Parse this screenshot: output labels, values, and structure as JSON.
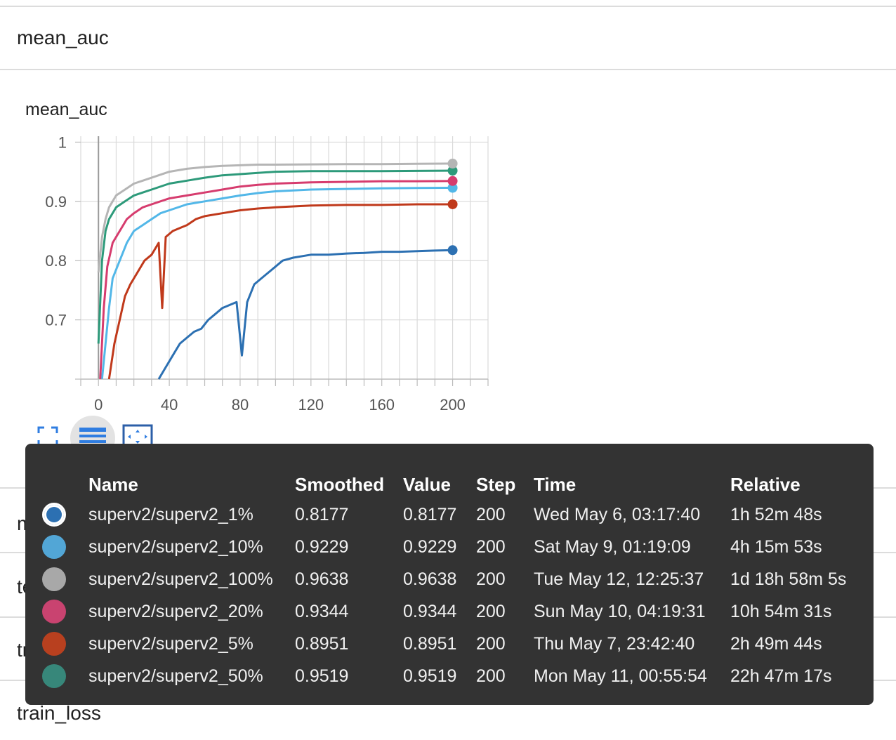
{
  "page": {
    "section_title": "mean_auc",
    "card_title": "mean_auc",
    "other_sections": [
      "mean_auc_train",
      "test_loss",
      "train_auc",
      "train_loss"
    ]
  },
  "toolbar": {
    "expand_icon": "fullscreen-icon",
    "legend_icon": "list-icon",
    "fit_icon": "fit-domain-icon"
  },
  "chart_data": {
    "type": "line",
    "xlim": [
      -10,
      220
    ],
    "ylim": [
      0.6,
      1.01
    ],
    "x_ticks": [
      "0",
      "40",
      "80",
      "120",
      "160",
      "200"
    ],
    "x_tick_values": [
      0,
      40,
      80,
      120,
      160,
      200
    ],
    "y_ticks": [
      "1",
      "0.9",
      "0.8",
      "0.7"
    ],
    "y_tick_values": [
      1,
      0.9,
      0.8,
      0.7
    ],
    "grid": true,
    "series": [
      {
        "name": "superv2/superv2_1%",
        "color": "#2c70b2",
        "points": [
          [
            34,
            0.6
          ],
          [
            38,
            0.62
          ],
          [
            42,
            0.64
          ],
          [
            46,
            0.66
          ],
          [
            50,
            0.67
          ],
          [
            54,
            0.68
          ],
          [
            58,
            0.685
          ],
          [
            62,
            0.7
          ],
          [
            66,
            0.71
          ],
          [
            70,
            0.72
          ],
          [
            74,
            0.725
          ],
          [
            78,
            0.73
          ],
          [
            81,
            0.64
          ],
          [
            84,
            0.73
          ],
          [
            88,
            0.76
          ],
          [
            92,
            0.77
          ],
          [
            96,
            0.78
          ],
          [
            100,
            0.79
          ],
          [
            104,
            0.8
          ],
          [
            110,
            0.805
          ],
          [
            120,
            0.81
          ],
          [
            130,
            0.81
          ],
          [
            140,
            0.812
          ],
          [
            150,
            0.813
          ],
          [
            160,
            0.815
          ],
          [
            170,
            0.815
          ],
          [
            180,
            0.816
          ],
          [
            190,
            0.817
          ],
          [
            200,
            0.8177
          ]
        ]
      },
      {
        "name": "superv2/superv2_5%",
        "color": "#c0391b",
        "points": [
          [
            6,
            0.6
          ],
          [
            9,
            0.66
          ],
          [
            12,
            0.7
          ],
          [
            15,
            0.74
          ],
          [
            18,
            0.76
          ],
          [
            22,
            0.78
          ],
          [
            26,
            0.8
          ],
          [
            30,
            0.81
          ],
          [
            34,
            0.83
          ],
          [
            36,
            0.72
          ],
          [
            38,
            0.84
          ],
          [
            42,
            0.85
          ],
          [
            46,
            0.855
          ],
          [
            50,
            0.86
          ],
          [
            55,
            0.87
          ],
          [
            60,
            0.875
          ],
          [
            70,
            0.88
          ],
          [
            80,
            0.885
          ],
          [
            90,
            0.888
          ],
          [
            100,
            0.89
          ],
          [
            120,
            0.893
          ],
          [
            140,
            0.894
          ],
          [
            160,
            0.894
          ],
          [
            180,
            0.895
          ],
          [
            200,
            0.8951
          ]
        ]
      },
      {
        "name": "superv2/superv2_10%",
        "color": "#52b7e8",
        "points": [
          [
            2,
            0.6
          ],
          [
            4,
            0.66
          ],
          [
            6,
            0.72
          ],
          [
            8,
            0.77
          ],
          [
            12,
            0.8
          ],
          [
            16,
            0.83
          ],
          [
            20,
            0.85
          ],
          [
            25,
            0.86
          ],
          [
            30,
            0.87
          ],
          [
            35,
            0.88
          ],
          [
            40,
            0.885
          ],
          [
            50,
            0.895
          ],
          [
            60,
            0.9
          ],
          [
            70,
            0.905
          ],
          [
            80,
            0.91
          ],
          [
            90,
            0.914
          ],
          [
            100,
            0.917
          ],
          [
            120,
            0.92
          ],
          [
            140,
            0.921
          ],
          [
            160,
            0.922
          ],
          [
            180,
            0.9225
          ],
          [
            200,
            0.9229
          ]
        ]
      },
      {
        "name": "superv2/superv2_20%",
        "color": "#d63c6e",
        "points": [
          [
            1,
            0.6
          ],
          [
            3,
            0.72
          ],
          [
            5,
            0.79
          ],
          [
            8,
            0.83
          ],
          [
            12,
            0.85
          ],
          [
            16,
            0.87
          ],
          [
            20,
            0.88
          ],
          [
            25,
            0.89
          ],
          [
            30,
            0.895
          ],
          [
            40,
            0.905
          ],
          [
            50,
            0.91
          ],
          [
            60,
            0.915
          ],
          [
            70,
            0.92
          ],
          [
            80,
            0.925
          ],
          [
            90,
            0.928
          ],
          [
            100,
            0.93
          ],
          [
            120,
            0.932
          ],
          [
            140,
            0.933
          ],
          [
            160,
            0.934
          ],
          [
            180,
            0.934
          ],
          [
            200,
            0.9344
          ]
        ]
      },
      {
        "name": "superv2/superv2_50%",
        "color": "#2d9a7a",
        "points": [
          [
            0,
            0.66
          ],
          [
            2,
            0.8
          ],
          [
            4,
            0.85
          ],
          [
            6,
            0.87
          ],
          [
            10,
            0.89
          ],
          [
            15,
            0.9
          ],
          [
            20,
            0.91
          ],
          [
            25,
            0.915
          ],
          [
            30,
            0.92
          ],
          [
            40,
            0.93
          ],
          [
            50,
            0.935
          ],
          [
            60,
            0.94
          ],
          [
            70,
            0.944
          ],
          [
            80,
            0.946
          ],
          [
            90,
            0.948
          ],
          [
            100,
            0.95
          ],
          [
            120,
            0.951
          ],
          [
            140,
            0.951
          ],
          [
            160,
            0.951
          ],
          [
            180,
            0.9515
          ],
          [
            200,
            0.9519
          ]
        ]
      },
      {
        "name": "superv2/superv2_100%",
        "color": "#b5b5b5",
        "points": [
          [
            0,
            0.78
          ],
          [
            2,
            0.84
          ],
          [
            4,
            0.87
          ],
          [
            6,
            0.89
          ],
          [
            10,
            0.91
          ],
          [
            15,
            0.92
          ],
          [
            20,
            0.93
          ],
          [
            25,
            0.935
          ],
          [
            30,
            0.94
          ],
          [
            40,
            0.95
          ],
          [
            50,
            0.955
          ],
          [
            60,
            0.958
          ],
          [
            70,
            0.96
          ],
          [
            80,
            0.961
          ],
          [
            90,
            0.962
          ],
          [
            100,
            0.962
          ],
          [
            120,
            0.9625
          ],
          [
            140,
            0.963
          ],
          [
            160,
            0.963
          ],
          [
            180,
            0.9635
          ],
          [
            200,
            0.9638
          ]
        ]
      }
    ]
  },
  "tooltip": {
    "headers": {
      "name": "Name",
      "smoothed": "Smoothed",
      "value": "Value",
      "step": "Step",
      "time": "Time",
      "relative": "Relative"
    },
    "rows": [
      {
        "color": "#2c70b2",
        "name": "superv2/superv2_1%",
        "smoothed": "0.8177",
        "value": "0.8177",
        "step": "200",
        "time": "Wed May 6, 03:17:40",
        "relative": "1h 52m 48s",
        "selected": true
      },
      {
        "color": "#52a6d6",
        "name": "superv2/superv2_10%",
        "smoothed": "0.9229",
        "value": "0.9229",
        "step": "200",
        "time": "Sat May 9, 01:19:09",
        "relative": "4h 15m 53s"
      },
      {
        "color": "#a8a8a8",
        "name": "superv2/superv2_100%",
        "smoothed": "0.9638",
        "value": "0.9638",
        "step": "200",
        "time": "Tue May 12, 12:25:37",
        "relative": "1d 18h 58m 5s"
      },
      {
        "color": "#c94370",
        "name": "superv2/superv2_20%",
        "smoothed": "0.9344",
        "value": "0.9344",
        "step": "200",
        "time": "Sun May 10, 04:19:31",
        "relative": "10h 54m 31s"
      },
      {
        "color": "#b8401f",
        "name": "superv2/superv2_5%",
        "smoothed": "0.8951",
        "value": "0.8951",
        "step": "200",
        "time": "Thu May 7, 23:42:40",
        "relative": "2h 49m 44s"
      },
      {
        "color": "#37877a",
        "name": "superv2/superv2_50%",
        "smoothed": "0.9519",
        "value": "0.9519",
        "step": "200",
        "time": "Mon May 11, 00:55:54",
        "relative": "22h 47m 17s"
      }
    ]
  }
}
